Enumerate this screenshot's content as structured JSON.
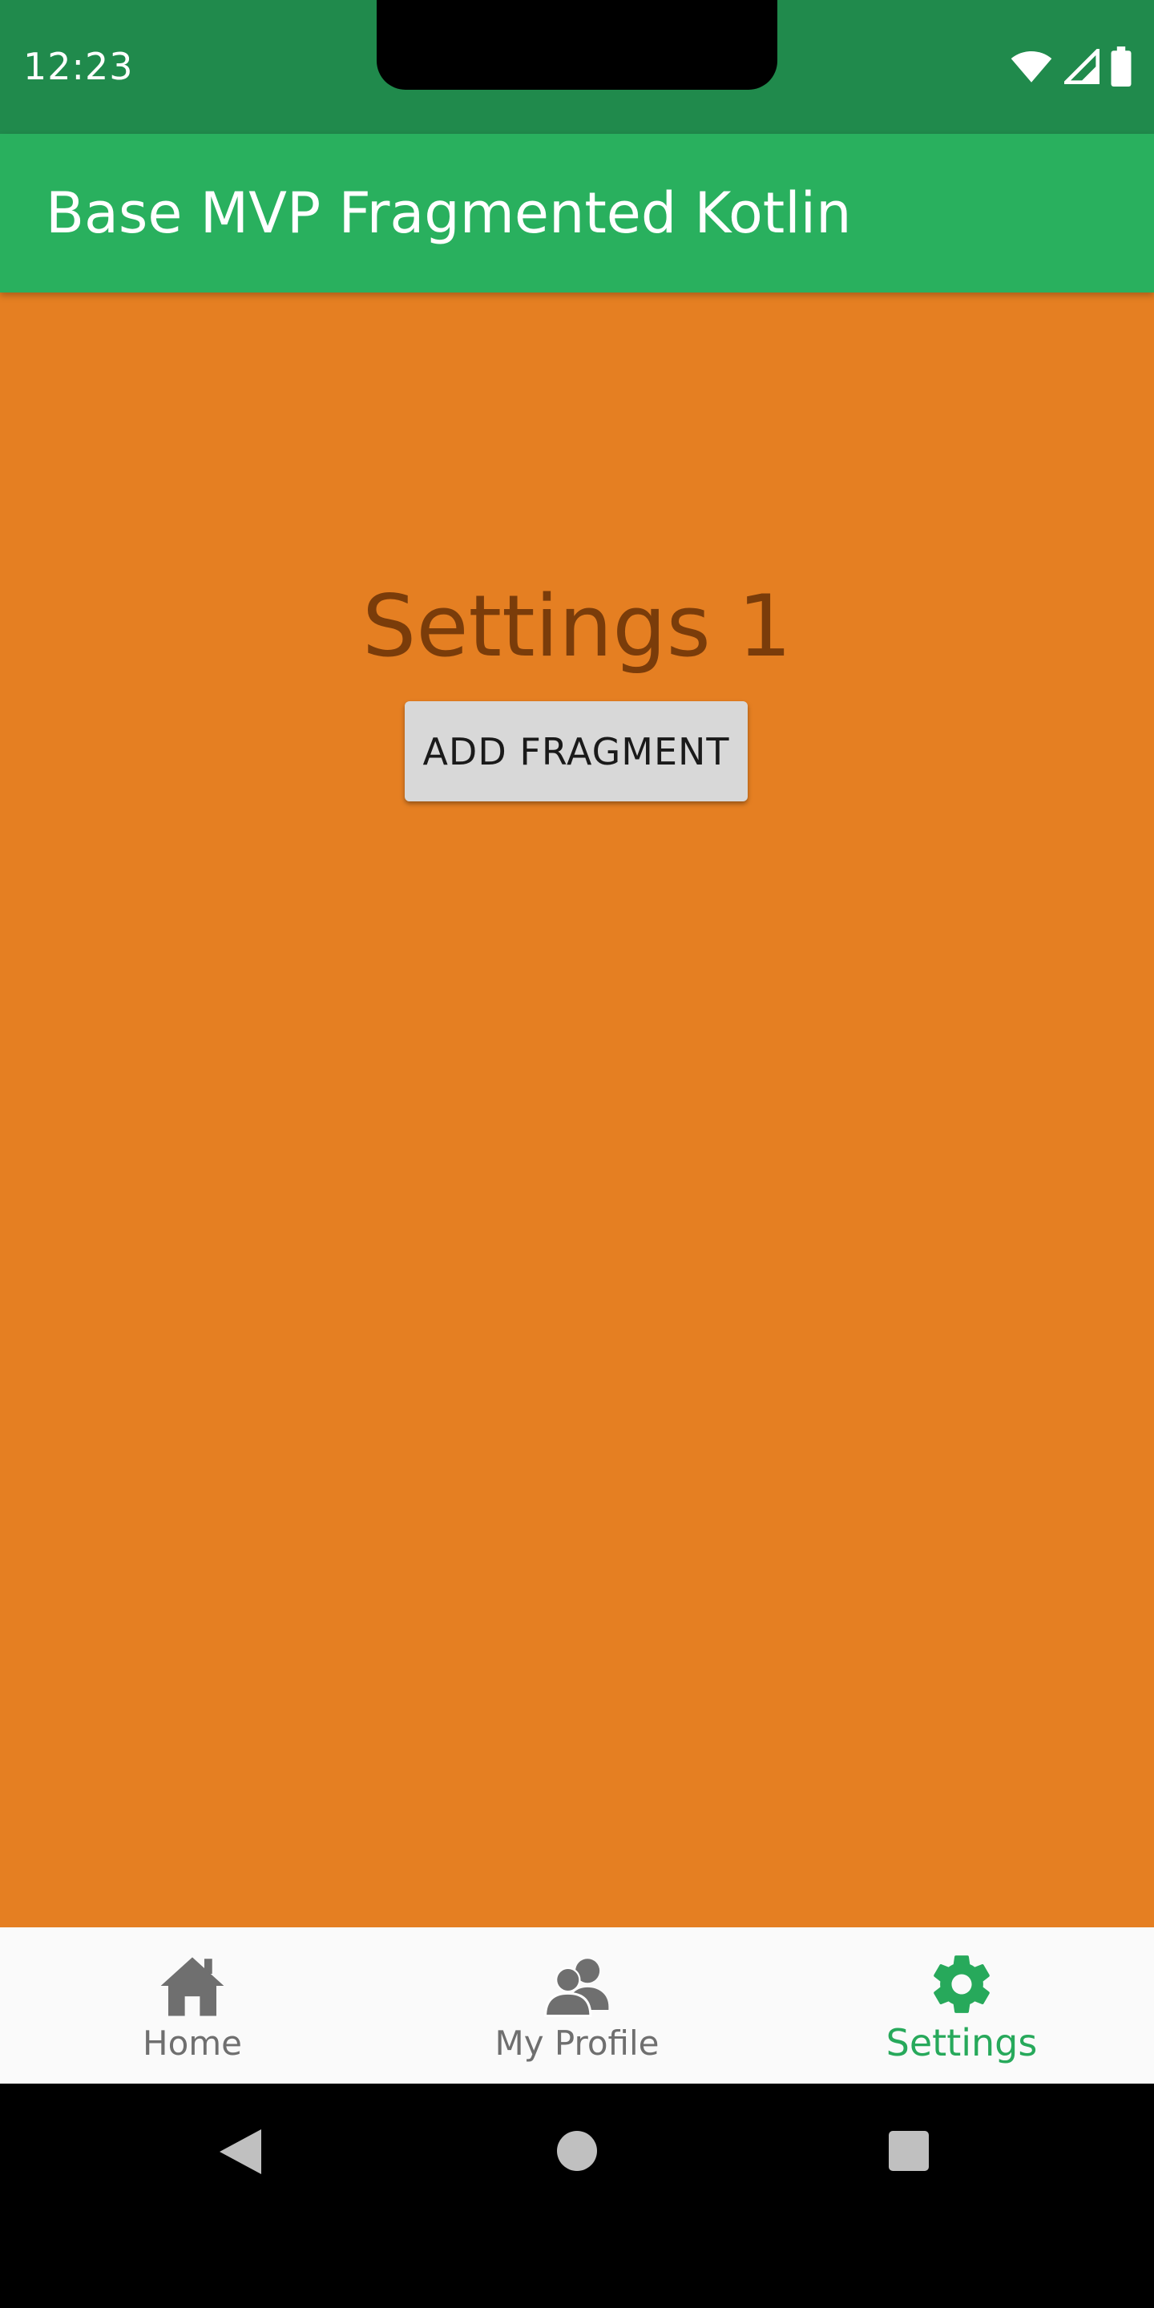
{
  "status_bar": {
    "time": "12:23",
    "icons": [
      "wifi-icon",
      "cell-signal-icon",
      "battery-icon"
    ],
    "color": "#208a4c"
  },
  "app_bar": {
    "title": "Base MVP Fragmented Kotlin",
    "color": "#29b05e"
  },
  "content": {
    "heading": "Settings 1",
    "add_button_label": "ADD FRAGMENT",
    "background": "#e57f22"
  },
  "bottom_nav": {
    "items": [
      {
        "label": "Home",
        "icon": "home-icon",
        "active": false
      },
      {
        "label": "My Profile",
        "icon": "profile-icon",
        "active": false
      },
      {
        "label": "Settings",
        "icon": "gear-icon",
        "active": true
      }
    ],
    "active_color": "#27a95b",
    "inactive_color": "#6f6f6f"
  },
  "system_nav": {
    "buttons": [
      "back-icon",
      "home-circle-icon",
      "recents-icon"
    ]
  }
}
